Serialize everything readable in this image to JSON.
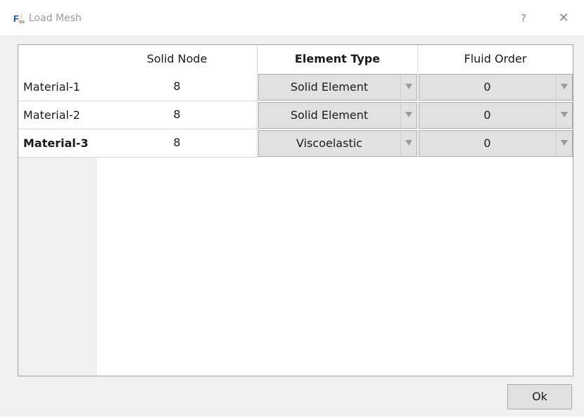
{
  "window": {
    "title": "Load Mesh",
    "help_label": "?",
    "close_label": "✕",
    "app_icon": "fss-logo-icon"
  },
  "table": {
    "columns": [
      "Solid Node",
      "Element Type",
      "Fluid Order"
    ],
    "rows": [
      {
        "label": "Material-1",
        "solid_node": "8",
        "element_type": "Solid Element",
        "fluid_order": "0"
      },
      {
        "label": "Material-2",
        "solid_node": "8",
        "element_type": "Solid Element",
        "fluid_order": "0"
      },
      {
        "label": "Material-3",
        "solid_node": "8",
        "element_type": "Viscoelastic",
        "fluid_order": "0"
      }
    ]
  },
  "footer": {
    "ok_label": "Ok"
  },
  "colors": {
    "title_text": "#9a9a9a",
    "button_face": "#e1e1e1",
    "dialog_bg": "#f0f0f0"
  }
}
